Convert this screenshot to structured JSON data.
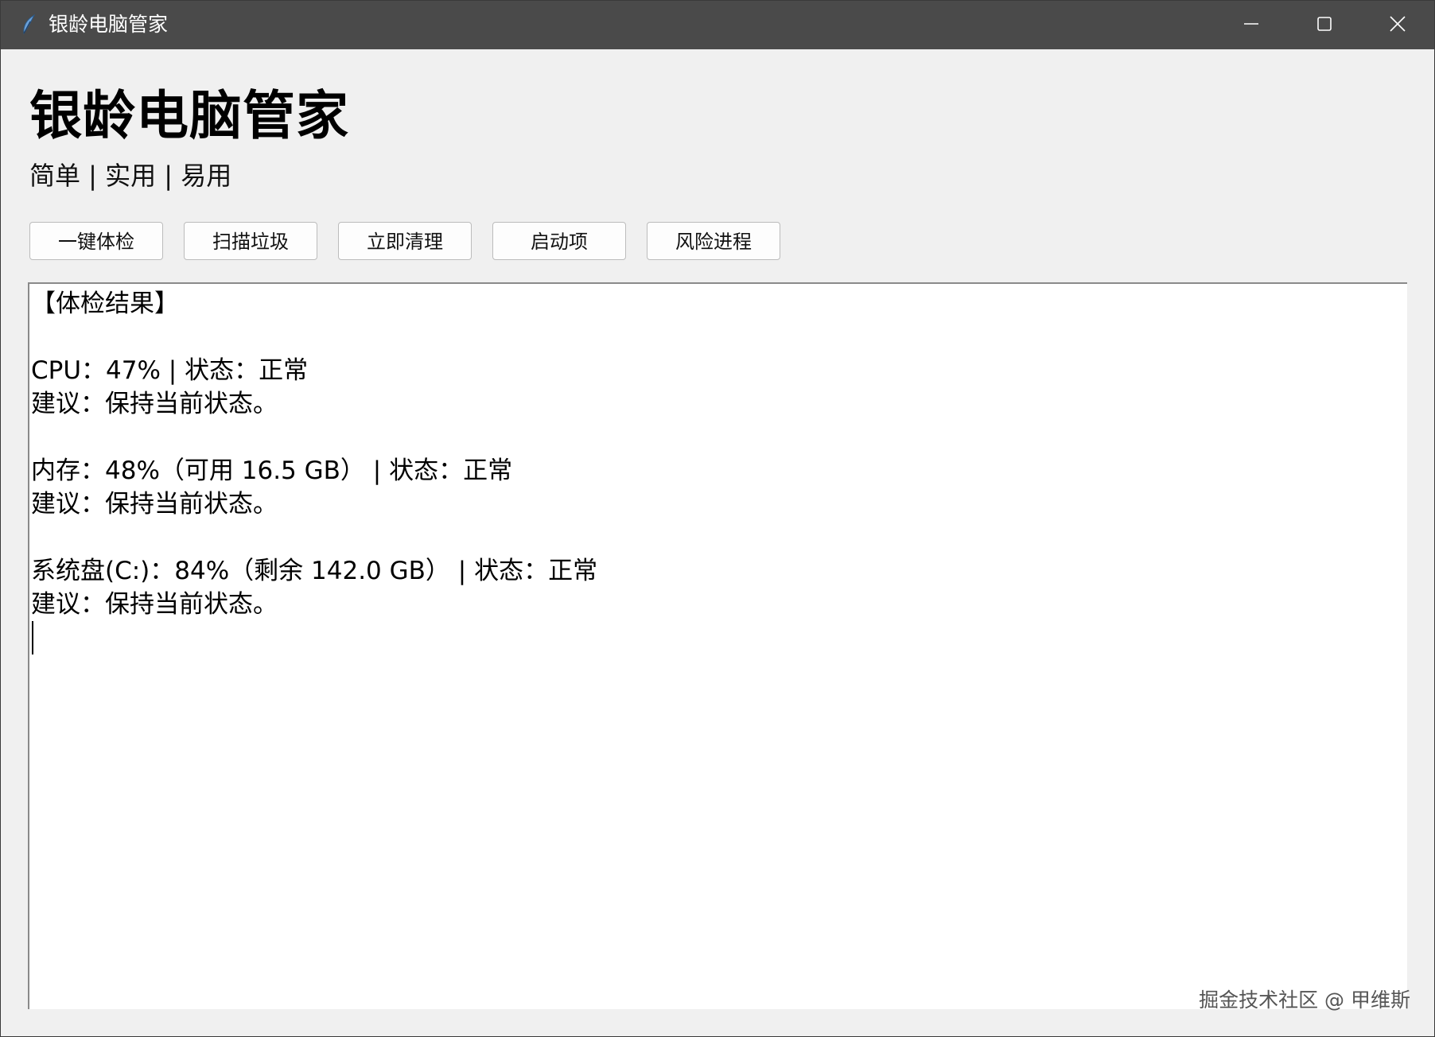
{
  "window": {
    "title": "银龄电脑管家",
    "icon": "feather-icon",
    "controls": [
      "minimize-icon",
      "maximize-icon",
      "close-icon"
    ]
  },
  "header": {
    "title": "银龄电脑管家",
    "subtitle": "简单 | 实用 | 易用"
  },
  "toolbar": {
    "buttons": [
      {
        "label": "一键体检"
      },
      {
        "label": "扫描垃圾"
      },
      {
        "label": "立即清理"
      },
      {
        "label": "启动项"
      },
      {
        "label": "风险进程"
      }
    ]
  },
  "result": {
    "lines": [
      "【体检结果】",
      "",
      "CPU：47% | 状态：正常",
      "建议：保持当前状态。",
      "",
      "内存：48%（可用 16.5 GB） | 状态：正常",
      "建议：保持当前状态。",
      "",
      "系统盘(C:)：84%（剩余 142.0 GB） | 状态：正常",
      "建议：保持当前状态。"
    ]
  },
  "watermark": "掘金技术社区 @ 甲维斯",
  "colors": {
    "titlebar": "#4a4a4a",
    "window_bg": "#f0f0f0",
    "text_area_bg": "#ffffff"
  }
}
